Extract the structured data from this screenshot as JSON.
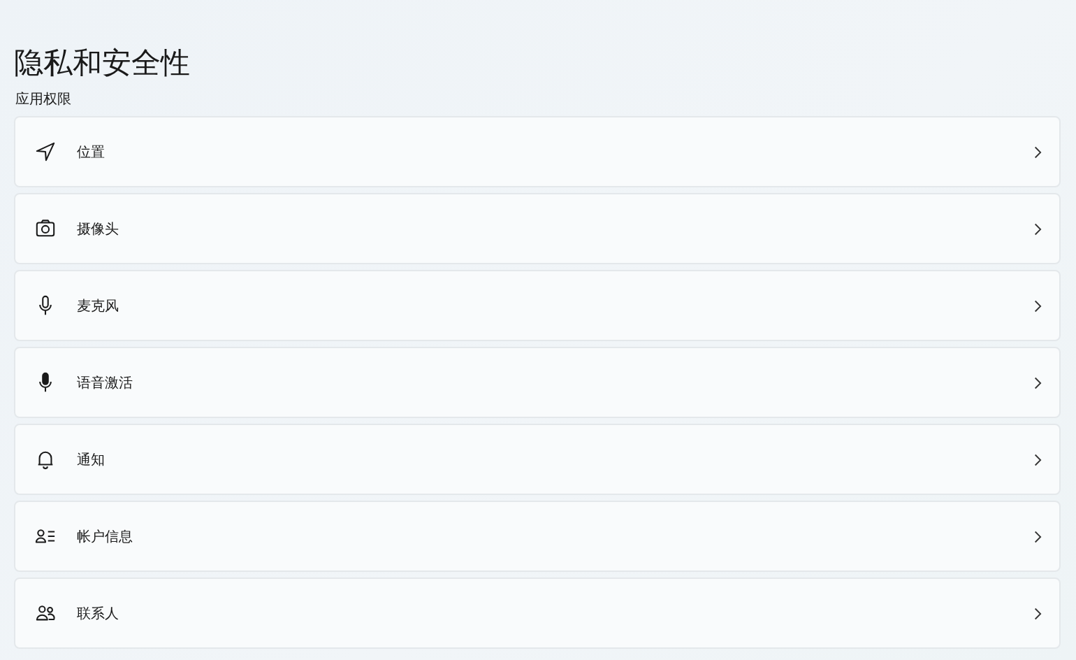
{
  "title": "隐私和安全性",
  "section": "应用权限",
  "items": [
    {
      "label": "位置"
    },
    {
      "label": "摄像头"
    },
    {
      "label": "麦克风"
    },
    {
      "label": "语音激活"
    },
    {
      "label": "通知"
    },
    {
      "label": "帐户信息"
    },
    {
      "label": "联系人"
    }
  ]
}
